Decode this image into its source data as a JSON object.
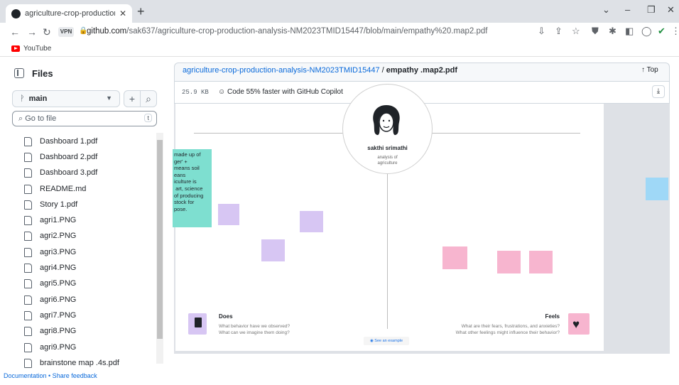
{
  "browser": {
    "tab_title": "agriculture-crop-production-ana",
    "new_tab": "+",
    "url_host": "github.com",
    "url_path": "/sak637/agriculture-crop-production-analysis-NM2023TMID15447/blob/main/empathy%20.map2.pdf",
    "vpn_label": "VPN",
    "bookmark": "YouTube",
    "window_controls": [
      "⌄",
      "–",
      "❐",
      "✕"
    ]
  },
  "sidebar": {
    "title": "Files",
    "branch": "main",
    "goto_placeholder": "Go to file",
    "goto_shortcut": "t",
    "files": [
      "Dashboard 1.pdf",
      "Dashboard 2.pdf",
      "Dashboard 3.pdf",
      "README.md",
      "Story 1.pdf",
      "agri1.PNG",
      "agri2.PNG",
      "agri3.PNG",
      "agri4.PNG",
      "agri5.PNG",
      "agri6.PNG",
      "agri7.PNG",
      "agri8.PNG",
      "agri9.PNG",
      "brainstone map .4s.pdf"
    ],
    "footer": "Documentation • Share feedback"
  },
  "main": {
    "repo": "agriculture-crop-production-analysis-NM2023TMID15447",
    "separator": "/",
    "filename": "empathy .map2.pdf",
    "top_label": "Top",
    "size": "25.9 KB",
    "copilot": "Code 55% faster with GitHub Copilot"
  },
  "pdf": {
    "persona_name": "sakthi srimathi",
    "persona_desc_1": "analysis of",
    "persona_desc_2": "agriculture",
    "green_note": "made up of\nger' +\nmeans soil\neans\niculture is\n art, science\nof producing\nstock for\npose.",
    "does_title": "Does",
    "does_q1": "What behavior have we observed?",
    "does_q2": "What can we imagine them doing?",
    "feels_title": "Feels",
    "feels_q1": "What are their fears, frustrations, and anxieties?",
    "feels_q2": "What other feelings might influence their behavior?",
    "example_label": "See an example"
  },
  "colors": {
    "link": "#0969da",
    "green_note": "#7edfd0",
    "purple_note": "#d7c6f3",
    "pink_note": "#f7b5cf",
    "blue_note": "#9fd8f7"
  }
}
